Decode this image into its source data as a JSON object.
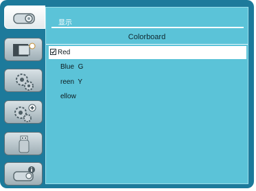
{
  "menu": {
    "title": "显示",
    "subheader": "Colorboard",
    "items": [
      {
        "label": "Red",
        "checked": true
      },
      {
        "label": "Blue  G"
      },
      {
        "label": "reen  Y"
      },
      {
        "label": "ellow"
      }
    ]
  },
  "tabs": [
    {
      "icon": "projector-icon",
      "active": true
    },
    {
      "icon": "display-picture-icon"
    },
    {
      "icon": "settings-gear-icon"
    },
    {
      "icon": "extended-settings-icon"
    },
    {
      "icon": "usb-memory-icon"
    },
    {
      "icon": "info-icon"
    }
  ],
  "colors": {
    "frame": "#1d7a9b",
    "panel": "#5bc3d8",
    "selected_row": "#ffffff"
  }
}
